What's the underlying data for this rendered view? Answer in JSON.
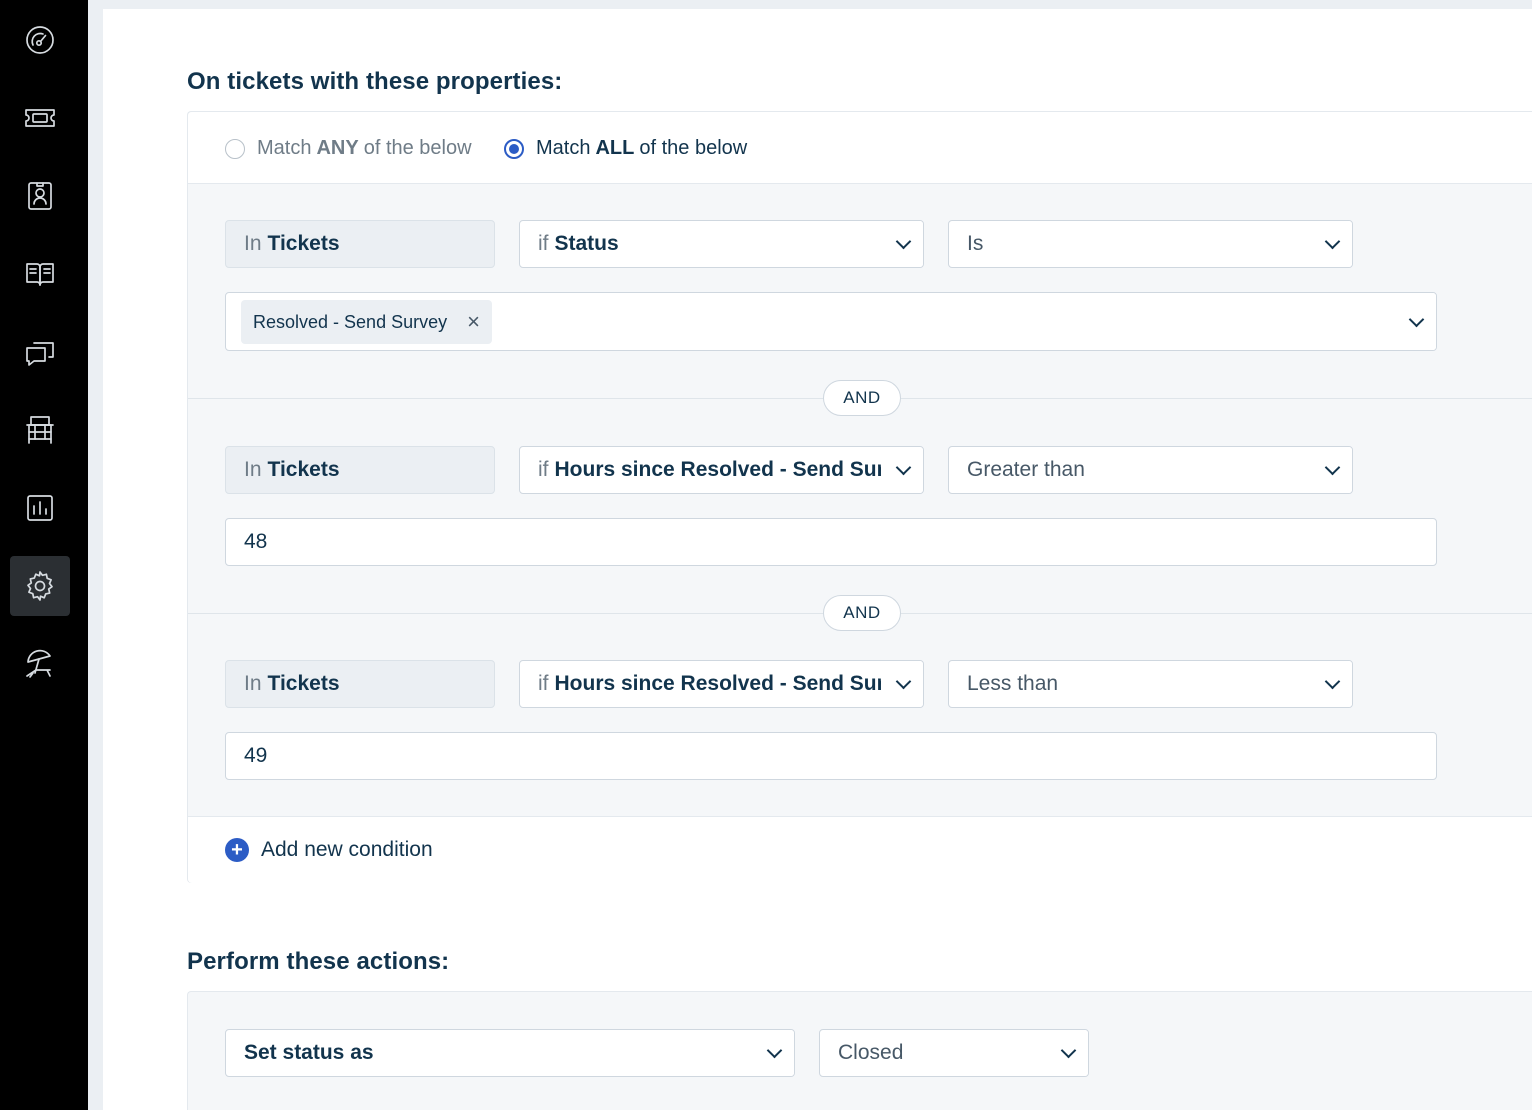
{
  "sidebar": {
    "items": [
      {
        "icon": "dashboard-icon"
      },
      {
        "icon": "tickets-icon"
      },
      {
        "icon": "contacts-icon"
      },
      {
        "icon": "solutions-icon"
      },
      {
        "icon": "discussions-icon"
      },
      {
        "icon": "assets-icon"
      },
      {
        "icon": "reports-icon"
      },
      {
        "icon": "admin-gear-icon",
        "active": true
      },
      {
        "icon": "beach-chair-icon"
      }
    ]
  },
  "conditions": {
    "title": "On tickets with these properties:",
    "match_any": {
      "pre": "Match",
      "bold": "ANY",
      "post": "of the below",
      "checked": false
    },
    "match_all": {
      "pre": "Match",
      "bold": "ALL",
      "post": "of the below",
      "checked": true
    },
    "rows": [
      {
        "in_prefix": "In",
        "in_value": "Tickets",
        "if_prefix": "if",
        "if_value": "Status",
        "operator": "Is",
        "tag": "Resolved - Send Survey",
        "tag_remove": "×"
      },
      {
        "in_prefix": "In",
        "in_value": "Tickets",
        "if_prefix": "if",
        "if_value": "Hours since Resolved - Send Survey",
        "operator": "Greater than",
        "value": "48"
      },
      {
        "in_prefix": "In",
        "in_value": "Tickets",
        "if_prefix": "if",
        "if_value": "Hours since Resolved - Send Survey",
        "operator": "Less than",
        "value": "49"
      }
    ],
    "connector": "AND",
    "add_condition": "Add new condition",
    "add_icon": "+"
  },
  "actions": {
    "title": "Perform these actions:",
    "action": "Set status as",
    "value": "Closed"
  },
  "colors": {
    "sidebar_bg": "#000000",
    "primary": "#2c5cc5",
    "text": "#12344d"
  }
}
